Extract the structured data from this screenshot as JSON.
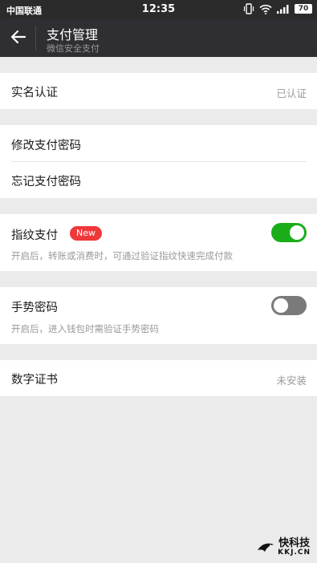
{
  "status_bar": {
    "carrier": "中国联通",
    "time": "12:35",
    "battery": "70",
    "icons": [
      "vibrate-icon",
      "wifi-icon",
      "signal-icon",
      "battery-icon"
    ]
  },
  "header": {
    "title": "支付管理",
    "subtitle": "微信安全支付"
  },
  "items": {
    "real_name": {
      "label": "实名认证",
      "value": "已认证"
    },
    "change_password": {
      "label": "修改支付密码"
    },
    "forgot_password": {
      "label": "忘记支付密码"
    },
    "fingerprint": {
      "label": "指纹支付",
      "badge": "New",
      "desc": "开启后，转账或消费时，可通过验证指纹快速完成付款",
      "enabled": true
    },
    "gesture": {
      "label": "手势密码",
      "desc": "开启后，进入钱包时需验证手势密码",
      "enabled": false
    },
    "certificate": {
      "label": "数字证书",
      "value": "未安装"
    }
  },
  "watermark": {
    "text": "快科技",
    "sub": "KKJ.CN"
  },
  "colors": {
    "toggle_on": "#1aad19",
    "toggle_off": "#7a7a7a",
    "badge": "#f0373a",
    "header_bg": "#2f2f33"
  }
}
